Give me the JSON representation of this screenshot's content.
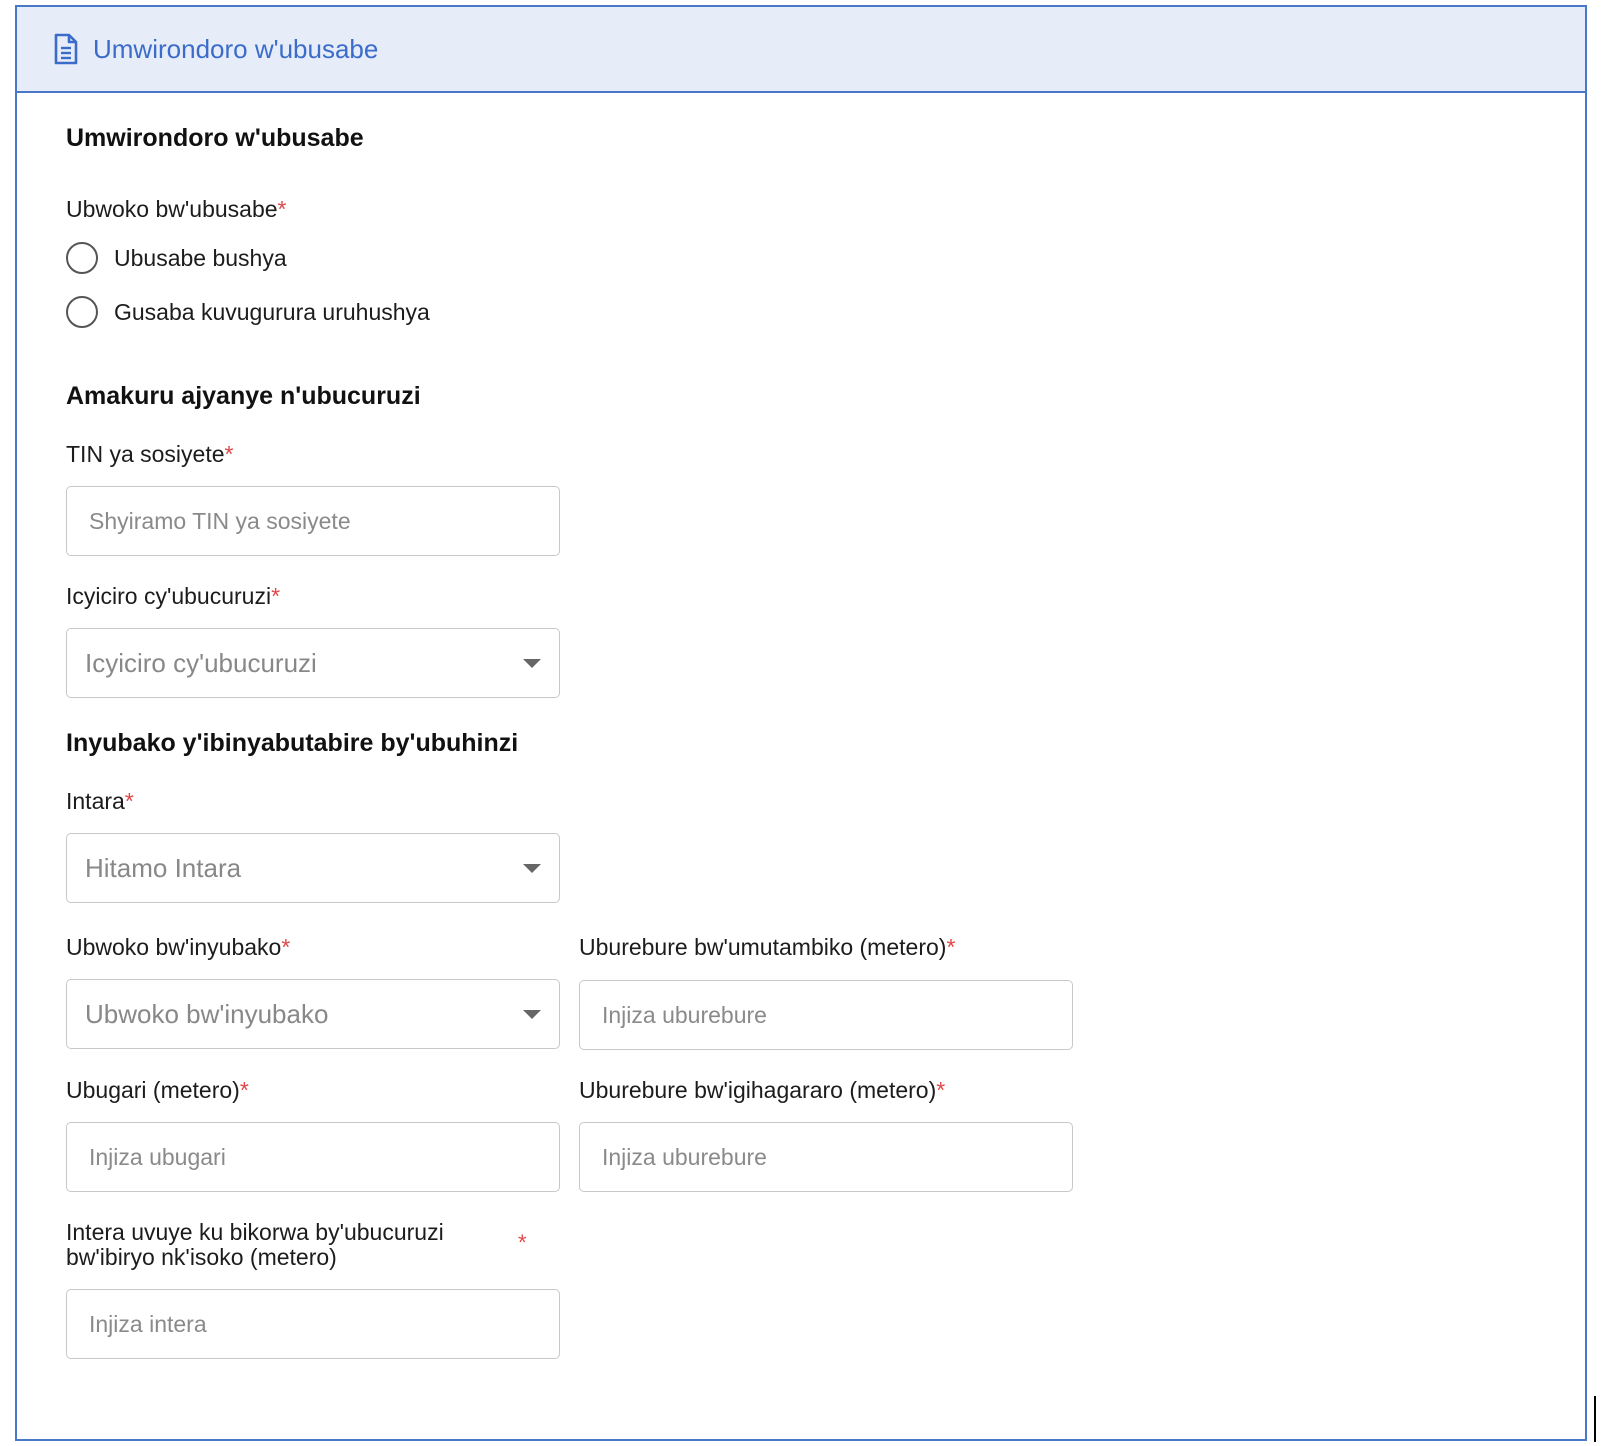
{
  "header": {
    "title": "Umwirondoro w'ubusabe",
    "icon": "document-icon"
  },
  "sections": {
    "profile": {
      "title": "Umwirondoro w'ubusabe",
      "request_type": {
        "label": "Ubwoko bw'ubusabe",
        "required": "*",
        "options": [
          "Ubusabe bushya",
          "Gusaba kuvugurura uruhushya"
        ]
      }
    },
    "business": {
      "title": "Amakuru ajyanye n'ubucuruzi",
      "tin": {
        "label": "TIN ya sosiyete",
        "required": "*",
        "placeholder": "Shyiramo TIN ya sosiyete"
      },
      "branch": {
        "label": "Icyiciro cy'ubucuruzi",
        "required": "*",
        "placeholder": "Icyiciro cy'ubucuruzi"
      }
    },
    "facility": {
      "title": "Inyubako y'ibinyabutabire by'ubuhinzi",
      "province": {
        "label": "Intara",
        "required": "*",
        "placeholder": "Hitamo Intara"
      },
      "building_type": {
        "label": "Ubwoko bw'inyubako",
        "required": "*",
        "placeholder": "Ubwoko bw'inyubako"
      },
      "storage_length": {
        "label": "Uburebure bw'umutambiko (metero)",
        "required": "*",
        "placeholder": "Injiza uburebure"
      },
      "width": {
        "label": "Ubugari (metero)",
        "required": "*",
        "placeholder": "Injiza ubugari"
      },
      "height": {
        "label": "Uburebure bw'igihagararo (metero)",
        "required": "*",
        "placeholder": "Injiza uburebure"
      },
      "distance": {
        "label_line1": "Intera uvuye ku bikorwa by'ubucuruzi",
        "label_line2": "bw'ibiryo nk'isoko (metero)",
        "required": "*",
        "placeholder": "Injiza intera"
      }
    }
  },
  "colors": {
    "accent": "#3b6cc9",
    "header_bg": "#e6edf9",
    "border": "#4a78c9",
    "required": "#e04848"
  }
}
